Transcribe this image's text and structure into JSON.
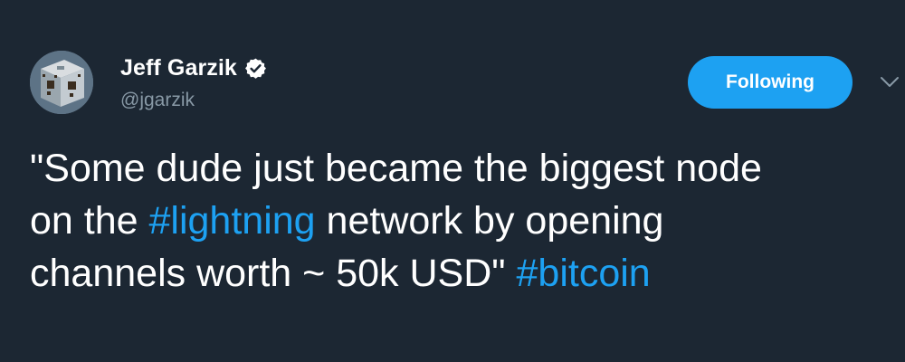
{
  "author": {
    "display_name": "Jeff Garzik",
    "handle": "@jgarzik",
    "verified": true,
    "avatar_icon": "menger-sponge-avatar"
  },
  "actions": {
    "follow_label": "Following",
    "more_icon": "chevron-down-icon"
  },
  "tweet": {
    "line1": "\"Some dude just became the biggest node",
    "line2_pre": "on the ",
    "hashtag_lightning": "#lightning",
    "line2_post": " network by opening",
    "line3_pre": "channels worth ~ 50k USD\" ",
    "hashtag_bitcoin": "#bitcoin"
  },
  "colors": {
    "background": "#1c2733",
    "accent": "#1da1f2",
    "secondary_text": "#8899a6",
    "primary_text": "#ffffff"
  }
}
